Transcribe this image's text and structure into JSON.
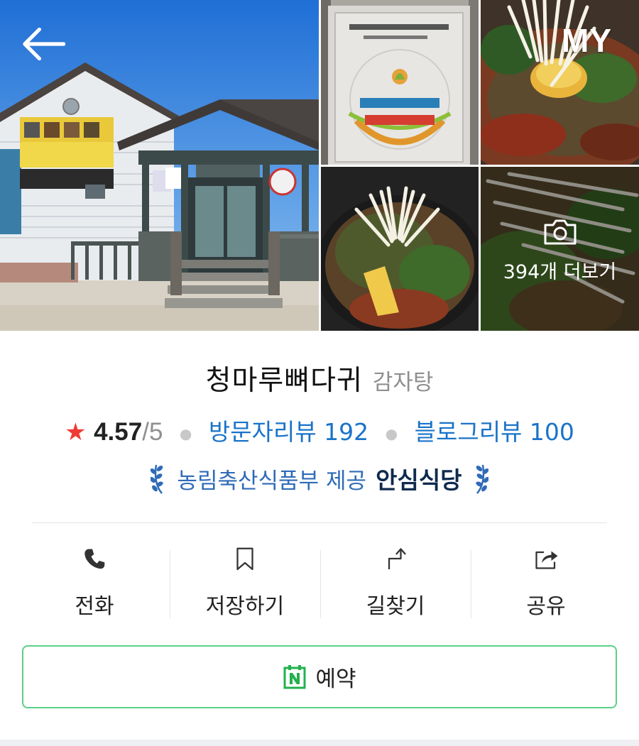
{
  "header": {
    "my_label": "MY"
  },
  "gallery": {
    "more_label": "394개 더보기"
  },
  "place": {
    "name": "청마루뼈다귀",
    "category": "감자탕"
  },
  "rating": {
    "score": "4.57",
    "max": "/5",
    "visitor_reviews": "방문자리뷰 192",
    "blog_reviews": "블로그리뷰 100"
  },
  "badge": {
    "provider": "농림축산식품부 제공",
    "title": "안심식당"
  },
  "actions": [
    {
      "label": "전화",
      "icon": "phone-icon"
    },
    {
      "label": "저장하기",
      "icon": "bookmark-icon"
    },
    {
      "label": "길찾기",
      "icon": "directions-icon"
    },
    {
      "label": "공유",
      "icon": "share-icon"
    }
  ],
  "reserve": {
    "label": "예약",
    "icon": "naver-n-icon"
  },
  "colors": {
    "link_blue": "#1a73c9",
    "star_red": "#f03a35",
    "badge_blue": "#2f6bb7",
    "badge_dark": "#0f2a4e",
    "reserve_green": "#5dcf88"
  }
}
